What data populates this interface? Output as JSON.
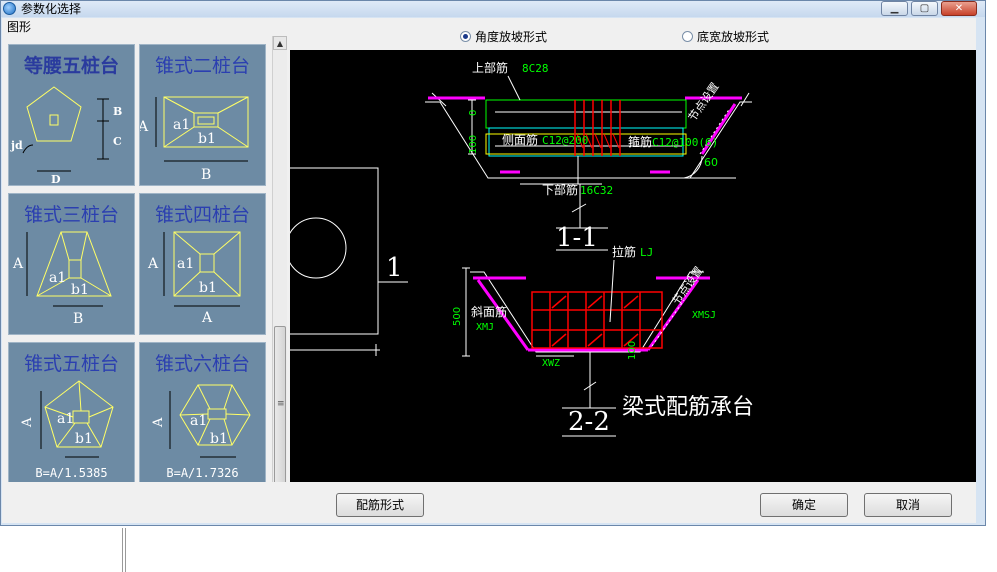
{
  "window": {
    "title": "参数化选择"
  },
  "left_panel": {
    "label": "图形"
  },
  "thumbnails": [
    {
      "title": "等腰五桩台",
      "labels": [
        "B",
        "C",
        "jd",
        "D"
      ]
    },
    {
      "title": "锥式二桩台",
      "labels": [
        "A",
        "a1",
        "b1",
        "B"
      ]
    },
    {
      "title": "锥式三桩台",
      "labels": [
        "A",
        "a1",
        "b1",
        "B"
      ]
    },
    {
      "title": "锥式四桩台",
      "labels": [
        "A",
        "a1",
        "b1",
        "A"
      ]
    },
    {
      "title": "锥式五桩台",
      "labels": [
        "A",
        "a1",
        "b1"
      ],
      "formula": "B=A/1.5385"
    },
    {
      "title": "锥式六桩台",
      "labels": [
        "A",
        "a1",
        "b1"
      ],
      "formula": "B=A/1.7326"
    }
  ],
  "slope_options": [
    {
      "label": "角度放坡形式",
      "selected": true
    },
    {
      "label": "底宽放坡形式",
      "selected": false
    }
  ],
  "drawing": {
    "section_1": "1",
    "top_rebar": "上部筋",
    "top_rebar_value": "8C28",
    "side_rebar": "侧面筋",
    "side_rebar_value": "C12@200",
    "stirrup": "箍筋",
    "stirrup_value": "C12@100(6)",
    "bottom_rebar": "下部筋",
    "bottom_rebar_value": "16C32",
    "angle": "60",
    "dim_0": "0",
    "dim_100": "100",
    "dim_0_rot": "0",
    "dim_100_rot": "100",
    "node_setting": "节点设置",
    "section_11": "1-1",
    "tie_bar": "拉筋",
    "tie_bar_value": "LJ",
    "slope_rebar": "斜面筋",
    "slope_rebar_value": "XMJ",
    "slope_stirrup": "XMSJ",
    "depth": "500",
    "xwz": "XWZ",
    "dim_100b": "100",
    "section_22": "2-2",
    "caption": "梁式配筋承台"
  },
  "buttons": {
    "rebar_form": "配筋形式",
    "ok": "确定",
    "cancel": "取消"
  },
  "colors": {
    "canvas_bg": "#000000",
    "outline": "#ffffff",
    "top_bar": "#00ff00",
    "cyan_bar": "#00ffff",
    "yellow_bar": "#ffff00",
    "red_rebar": "#ff0000",
    "magenta": "#ff00ff",
    "label_green": "#00ff00",
    "thumb_bg": "#6d8ba4",
    "thumb_title": "#2b3fb0"
  }
}
